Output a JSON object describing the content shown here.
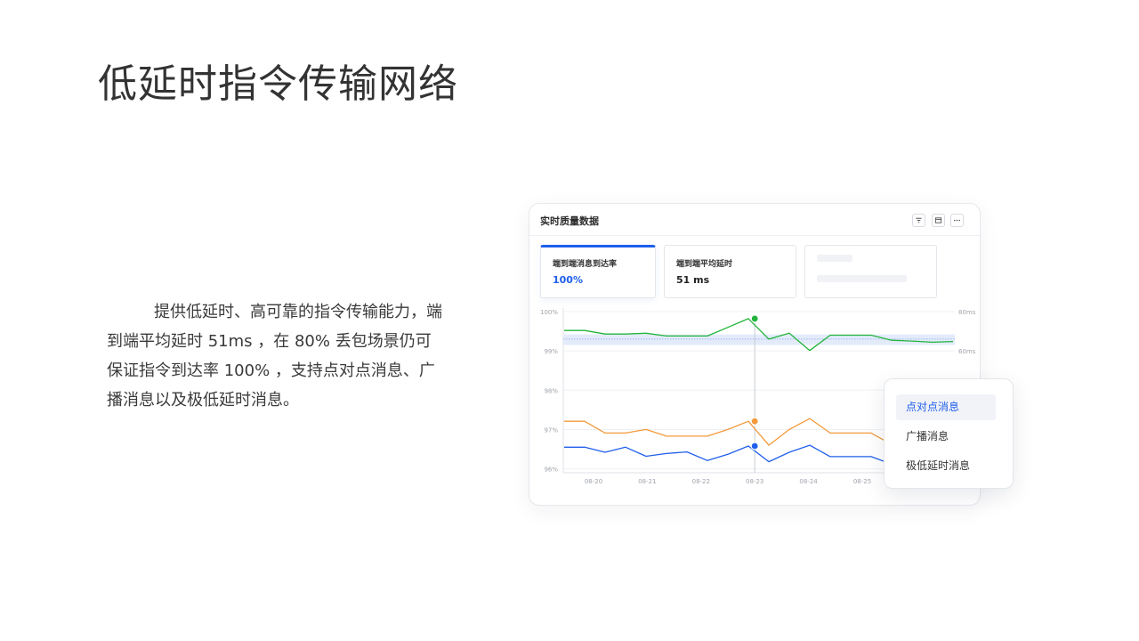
{
  "slide": {
    "title": "低延时指令传输网络",
    "description": "提供低延时、高可靠的指令传输能力，端到端平均延时 51ms ，在 80% 丢包场景仍可保证指令到达率 100% ，支持点对点消息、广播消息以及极低延时消息。"
  },
  "panel": {
    "title": "实时质量数据",
    "toolbar": {
      "filter_icon": "filter-icon",
      "window_icon": "window-icon",
      "more_icon": "more-icon"
    },
    "metrics": [
      {
        "label": "端到端消息到达率",
        "value": "100%",
        "active": true
      },
      {
        "label": "端到端平均延时",
        "value": "51 ms",
        "active": false
      }
    ]
  },
  "chart_data": {
    "type": "line",
    "x_ticks": [
      "08-20",
      "08-21",
      "08-22",
      "08-23",
      "08-24",
      "08-25"
    ],
    "left_axis": {
      "ticks": [
        "100%",
        "99%",
        "98%",
        "97%",
        "96%"
      ],
      "range": [
        95.9,
        100
      ]
    },
    "right_axis": {
      "ticks": [
        "80ms",
        "60ms"
      ]
    },
    "grid": true,
    "hover_date": "08-23",
    "series": [
      {
        "color": "#22b43a",
        "axis": "left",
        "values": [
          99.52,
          99.52,
          99.43,
          99.43,
          99.45,
          99.38,
          99.38,
          99.38,
          99.6,
          99.82,
          99.3,
          99.45,
          99.01,
          99.4,
          99.4,
          99.4,
          99.27,
          99.25,
          99.22,
          99.24
        ]
      },
      {
        "color": "#f29a3b",
        "axis": "left",
        "values": [
          97.21,
          97.21,
          96.91,
          96.91,
          97.0,
          96.83,
          96.83,
          96.83,
          97.0,
          97.21,
          96.6,
          97.0,
          97.28,
          96.91,
          96.91,
          96.91,
          96.62,
          96.6,
          96.62,
          96.6
        ]
      },
      {
        "color": "#1f5eea",
        "axis": "left",
        "values": [
          96.55,
          96.55,
          96.42,
          96.55,
          96.32,
          96.39,
          96.43,
          96.21,
          96.37,
          96.58,
          96.18,
          96.42,
          96.6,
          96.31,
          96.31,
          96.31,
          96.12,
          96.18,
          96.15,
          96.15
        ]
      }
    ],
    "target_band_color": "#e3ebfb"
  },
  "popup": {
    "items": [
      "点对点消息",
      "广播消息",
      "极低延时消息"
    ],
    "selected_index": 0
  },
  "colors": {
    "accent": "#1f5eea",
    "text": "#333333",
    "border": "#e3e6ea"
  }
}
